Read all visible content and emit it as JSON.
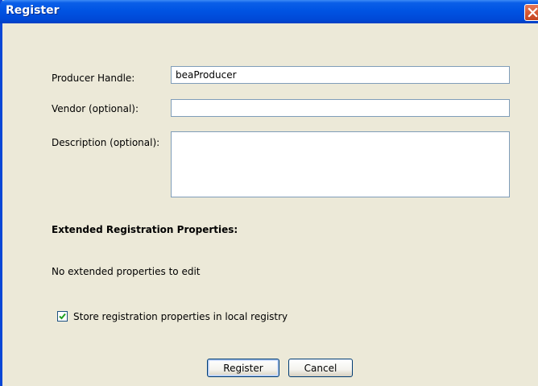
{
  "window": {
    "title": "Register"
  },
  "form": {
    "producer_handle": {
      "label": "Producer Handle:",
      "value": "beaProducer"
    },
    "vendor": {
      "label": "Vendor (optional):",
      "value": ""
    },
    "description": {
      "label": "Description (optional):",
      "value": ""
    }
  },
  "extended": {
    "heading": "Extended Registration Properties:",
    "empty_message": "No extended properties to edit"
  },
  "store_option": {
    "label": "Store registration properties in local registry",
    "checked": true
  },
  "buttons": {
    "register": "Register",
    "cancel": "Cancel"
  },
  "icons": {
    "close": "close-icon",
    "check": "check-icon"
  },
  "colors": {
    "titlebar": "#0054e3",
    "dialog_background": "#ece9d8",
    "input_border": "#7f9db9",
    "close_button": "#d65a34",
    "checkmark": "#21a121"
  }
}
